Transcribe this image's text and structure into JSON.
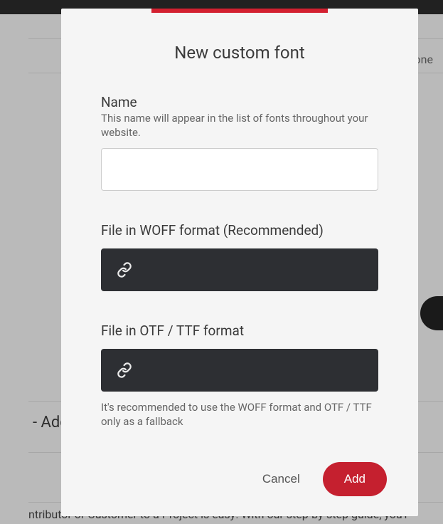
{
  "background": {
    "right_tab": "one",
    "add_line": "- Add",
    "bottom_text": "ntributor or Customer to a Project is easy! With our step-by-step guide, you'l"
  },
  "modal": {
    "title": "New custom font",
    "name_section": {
      "label": "Name",
      "hint": "This name will appear in the list of fonts throughout your website.",
      "value": ""
    },
    "woff_section": {
      "label": "File in WOFF format (Recommended)"
    },
    "otf_section": {
      "label": "File in OTF / TTF format",
      "recommend": "It's recommended to use the WOFF format and OTF / TTF only as a fallback"
    },
    "actions": {
      "cancel": "Cancel",
      "add": "Add"
    }
  }
}
